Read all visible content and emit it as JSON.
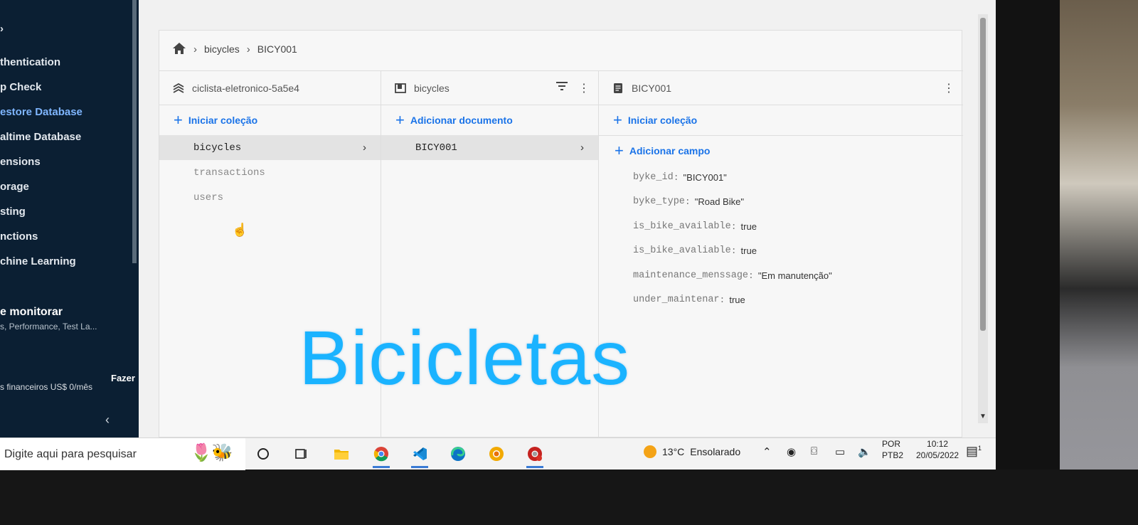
{
  "sidebar": {
    "items": [
      {
        "label": "thentication",
        "active": false
      },
      {
        "label": "p Check",
        "active": false
      },
      {
        "label": "estore Database",
        "active": true
      },
      {
        "label": "altime Database",
        "active": false
      },
      {
        "label": "ensions",
        "active": false
      },
      {
        "label": "orage",
        "active": false
      },
      {
        "label": "sting",
        "active": false
      },
      {
        "label": "nctions",
        "active": false
      },
      {
        "label": "chine Learning",
        "active": false
      }
    ],
    "monitor_title": "e monitorar",
    "monitor_subtitle": "s, Performance, Test La...",
    "plan_text": "s financeiros US$ 0/mês",
    "upgrade_label": "Fazer",
    "collapse_icon": "chevron-left-icon"
  },
  "breadcrumb": {
    "home_icon": "home-icon",
    "items": [
      "bicycles",
      "BICY001"
    ]
  },
  "columns": {
    "project": {
      "title": "ciclista-eletronico-5a5e4",
      "add_label": "Iniciar coleção",
      "collections": [
        "bicycles",
        "transactions",
        "users"
      ],
      "selected": "bicycles"
    },
    "collection": {
      "title": "bicycles",
      "add_label": "Adicionar documento",
      "documents": [
        "BICY001"
      ]
    },
    "document": {
      "title": "BICY001",
      "add_collection_label": "Iniciar coleção",
      "add_field_label": "Adicionar campo",
      "fields": [
        {
          "key": "byke_id",
          "value": "\"BICY001\""
        },
        {
          "key": "byke_type",
          "value": "\"Road Bike\""
        },
        {
          "key": "is_bike_available",
          "value": "true"
        },
        {
          "key": "is_bike_avaliable",
          "value": "true"
        },
        {
          "key": "maintenance_menssage",
          "value": "\"Em manutenção\""
        },
        {
          "key": "under_maintenar",
          "value": "true"
        }
      ]
    }
  },
  "overlay": {
    "title": "Bicicletas",
    "color": "#1ab3ff"
  },
  "taskbar": {
    "search_placeholder": "Digite aqui para pesquisar",
    "weather_temp": "13°C",
    "weather_text": "Ensolarado",
    "lang_top": "POR",
    "lang_bottom": "PTB2",
    "time": "10:12",
    "date": "20/05/2022",
    "notification_count": "1"
  },
  "colors": {
    "sidebar_bg": "#0b1f33",
    "accent_blue": "#1a73e8"
  }
}
